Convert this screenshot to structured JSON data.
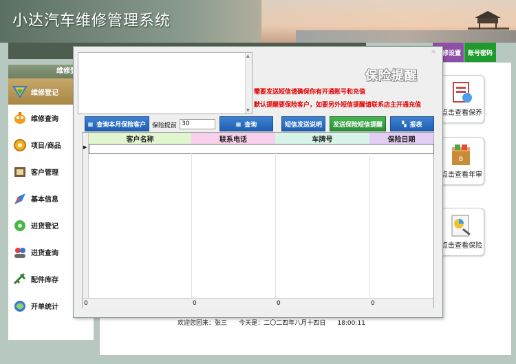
{
  "app": {
    "title": "小达汽车维修管理系统"
  },
  "top_buttons": [
    {
      "label": "修设置",
      "color": "#8e4fa8"
    },
    {
      "label": "账号密码",
      "color": "#1f9a2e"
    }
  ],
  "sidebar": {
    "title": "维修登记",
    "items": [
      {
        "label": "维修登记",
        "icon": "repair-register-icon",
        "active": true
      },
      {
        "label": "维修查询",
        "icon": "repair-query-icon"
      },
      {
        "label": "项目/商品",
        "icon": "project-goods-icon"
      },
      {
        "label": "客户管理",
        "icon": "customer-icon"
      },
      {
        "label": "基本信息",
        "icon": "basic-info-icon"
      },
      {
        "label": "进货登记",
        "icon": "purchase-register-icon"
      },
      {
        "label": "进货查询",
        "icon": "purchase-query-icon"
      },
      {
        "label": "配件库存",
        "icon": "parts-inventory-icon"
      },
      {
        "label": "开单统计",
        "icon": "order-stats-icon"
      }
    ]
  },
  "cards": [
    {
      "label": "点击查看保养",
      "icon": "maintenance-icon"
    },
    {
      "label": "点击查看年审",
      "icon": "annual-review-icon"
    },
    {
      "label": "点击查看保险",
      "icon": "insurance-icon"
    }
  ],
  "footer": {
    "welcome": "欢迎您回来：张三",
    "today": "今天是：二〇二四年八月十四日",
    "time": "18:00:11"
  },
  "dialog": {
    "title": "保险提醒",
    "close": "×",
    "notice1": "需要发送短信请确保你有开通账号和充值",
    "notice2": "默认提醒要保险客户，如要另外短信提醒请联系店主开通充值",
    "memo_text": "",
    "query_month_button": "查询本月保险客户",
    "advance_label": "保险提前",
    "advance_value": "30",
    "query_button": "查询",
    "sms_help_button": "短信发送说明",
    "send_sms_button": "发送保险短信提醒",
    "report_button": "报表",
    "grid": {
      "columns": [
        {
          "label": "客户名称",
          "color": "#e1f6cf"
        },
        {
          "label": "联系电话",
          "color": "#f8d0ec"
        },
        {
          "label": "车牌号",
          "color": "#d7f4e9"
        },
        {
          "label": "保险日期",
          "color": "#e2cdf4"
        }
      ],
      "rows": [],
      "footer": [
        "0",
        "0",
        "0",
        "0"
      ]
    }
  }
}
